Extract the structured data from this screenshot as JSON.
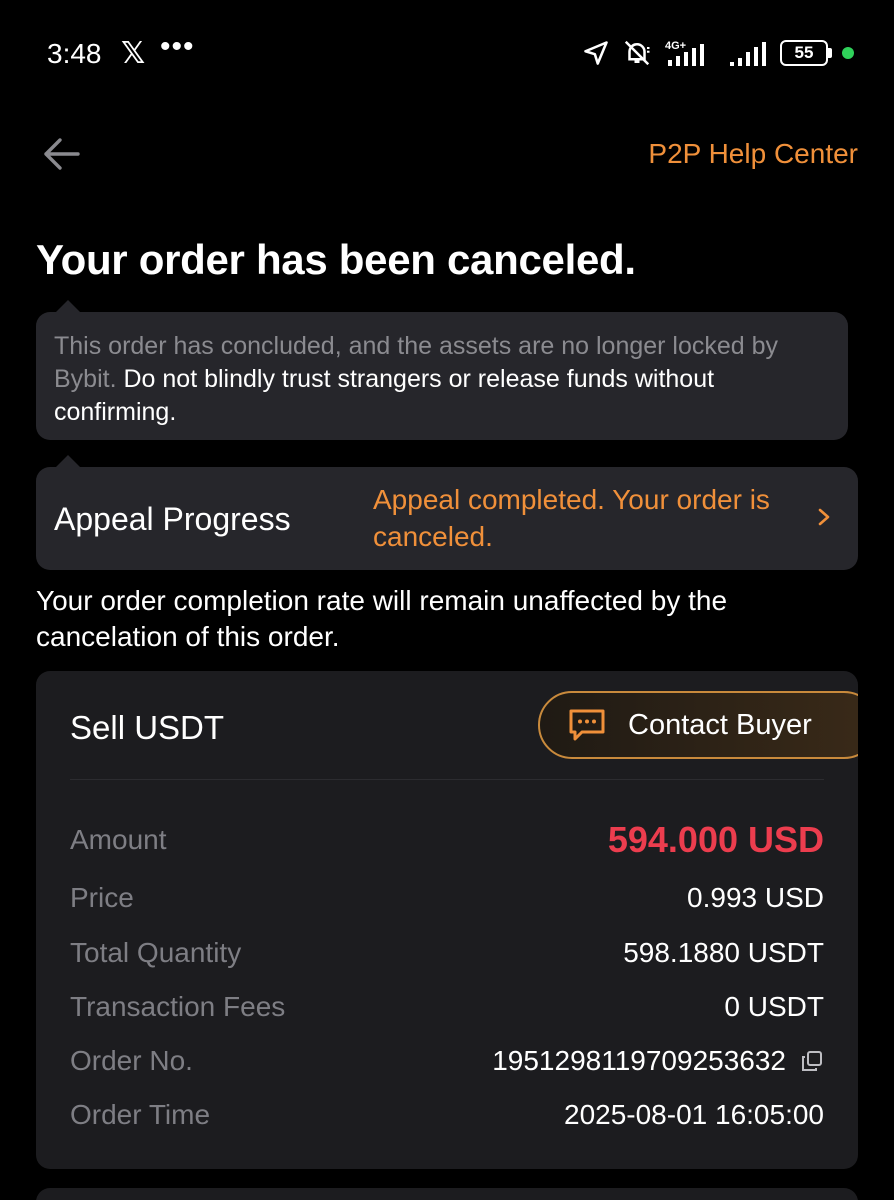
{
  "status_bar": {
    "time": "3:48",
    "x_app": "𝕏",
    "more": "•••",
    "network": "4G+",
    "battery": "55"
  },
  "header": {
    "help_link": "P2P Help Center"
  },
  "page": {
    "title": "Your order has been canceled."
  },
  "notice": {
    "muted_text": "This order has concluded, and the assets are no longer locked by Bybit.",
    "strong_text": "Do not blindly trust strangers or release funds without confirming."
  },
  "appeal": {
    "label": "Appeal Progress",
    "status": "Appeal completed. Your order is canceled."
  },
  "completion_note": "Your order completion rate will remain unaffected by the cancelation of this order.",
  "order": {
    "type": "Sell USDT",
    "contact_label": "Contact Buyer",
    "rows": {
      "amount": {
        "label": "Amount",
        "value": "594.000 USD"
      },
      "price": {
        "label": "Price",
        "value": "0.993 USD"
      },
      "quantity": {
        "label": "Total Quantity",
        "value": "598.1880 USDT"
      },
      "fees": {
        "label": "Transaction Fees",
        "value": "0 USDT"
      },
      "order_no": {
        "label": "Order No.",
        "value": "1951298119709253632"
      },
      "order_time": {
        "label": "Order Time",
        "value": "2025-08-01 16:05:00"
      }
    }
  },
  "colors": {
    "accent": "#f0903a",
    "amount_red": "#ec3d4e",
    "card_bg": "#1c1c1f",
    "panel_bg": "#26262b",
    "battery_dot": "#2fd15a"
  }
}
